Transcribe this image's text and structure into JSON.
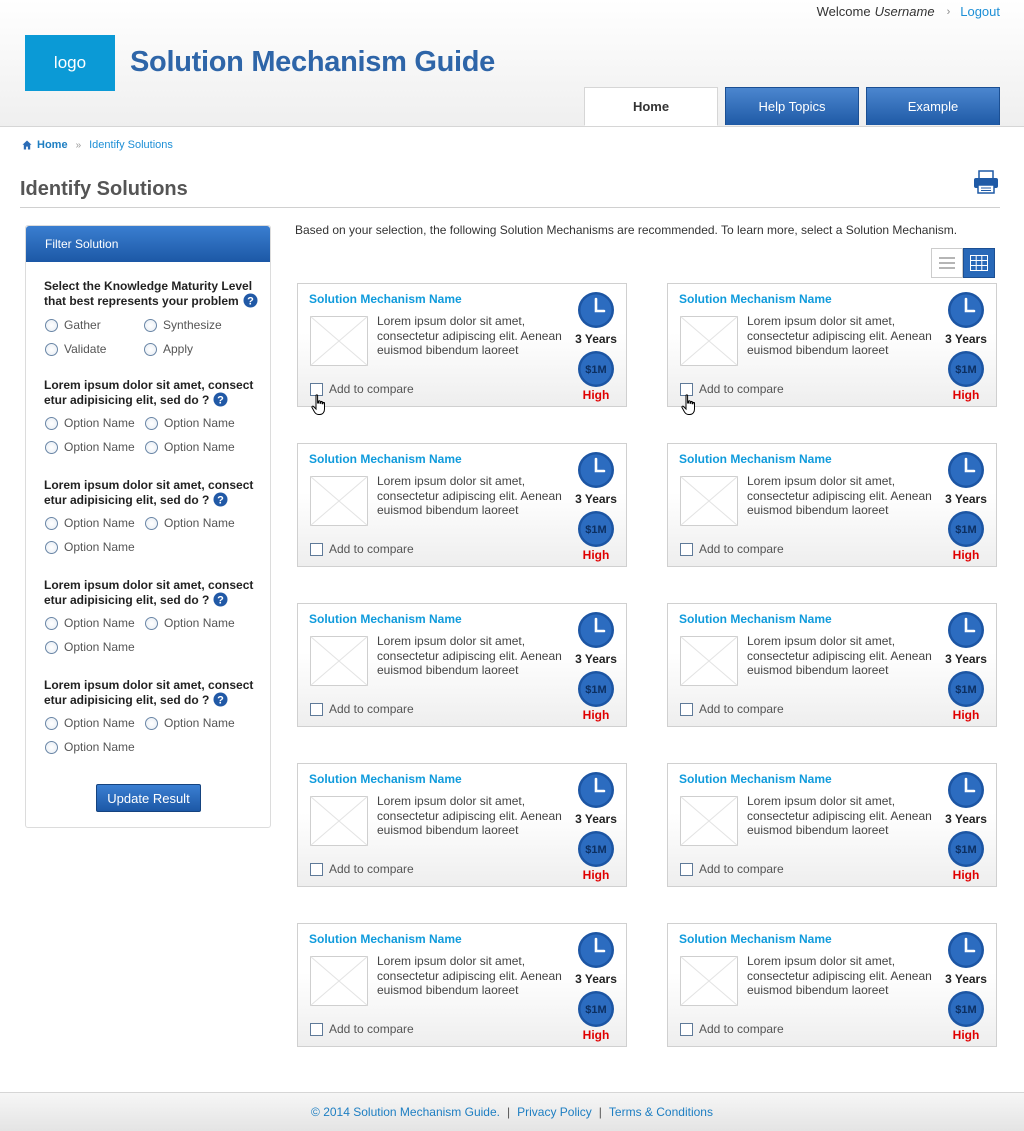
{
  "header": {
    "welcome": "Welcome",
    "username": "Username",
    "logout": "Logout",
    "logo": "logo",
    "site_title": "Solution Mechanism Guide",
    "tabs": [
      {
        "label": "Home",
        "active": true
      },
      {
        "label": "Help Topics",
        "active": false
      },
      {
        "label": "Example",
        "active": false
      }
    ]
  },
  "breadcrumb": {
    "home": "Home",
    "current": "Identify Solutions"
  },
  "page": {
    "title": "Identify Solutions"
  },
  "filter": {
    "title": "Filter Solution",
    "q1": "Select the Knowledge Maturity Level that best represents your problem",
    "q1_options": [
      "Gather",
      "Synthesize",
      "Validate",
      "Apply"
    ],
    "questions": [
      {
        "text": "Lorem ipsum dolor sit amet, consect etur adipisicing elit, sed do ?",
        "options": [
          "Option Name",
          "Option Name",
          "Option Name",
          "Option Name"
        ]
      },
      {
        "text": "Lorem ipsum dolor sit amet, consect etur adipisicing elit, sed do ?",
        "options": [
          "Option Name",
          "Option Name",
          "Option Name"
        ]
      },
      {
        "text": "Lorem ipsum dolor sit amet, consect etur adipisicing elit, sed do ?",
        "options": [
          "Option Name",
          "Option Name",
          "Option Name"
        ]
      },
      {
        "text": "Lorem ipsum dolor sit amet, consect etur adipisicing elit, sed do ?",
        "options": [
          "Option Name",
          "Option Name",
          "Option Name"
        ]
      }
    ],
    "update_button": "Update Result"
  },
  "results": {
    "intro": "Based on your selection, the following Solution Mechanisms are recommended.  To learn more, select a Solution Mechanism.",
    "card": {
      "name": "Solution Mechanism Name",
      "description": "Lorem ipsum dolor sit amet, consectetur adipiscing elit. Aenean euismod bibendum laoreet",
      "duration": "3 Years",
      "cost": "$1M",
      "risk": "High",
      "compare_label": "Add to compare"
    },
    "count": 10
  },
  "footer": {
    "copyright": "© 2014 Solution Mechanism Guide.",
    "privacy": "Privacy Policy",
    "terms": "Terms & Conditions"
  },
  "colors": {
    "brand_blue": "#2e65a8",
    "link_blue": "#0f9bdc",
    "risk_red": "#e00000",
    "logo_bg": "#0b9ad6"
  }
}
